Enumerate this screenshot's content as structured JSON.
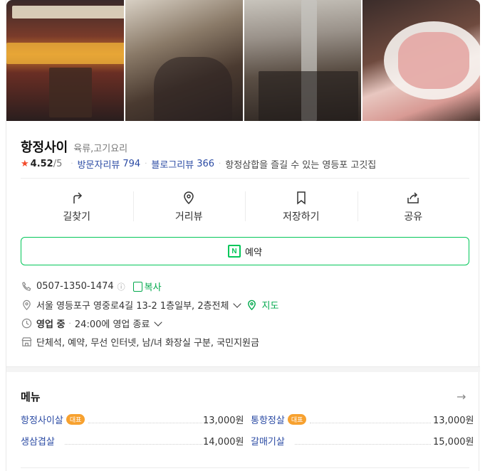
{
  "place": {
    "name": "항정사이",
    "category": "육류,고기요리",
    "rating": "4.52",
    "rating_max": "/5",
    "visitor_reviews_label": "방문자리뷰",
    "visitor_reviews_count": "794",
    "blog_reviews_label": "블로그리뷰",
    "blog_reviews_count": "366",
    "description": "항정삼합을 즐길 수 있는 영등포 고깃집"
  },
  "photos": [
    "storefront-photo",
    "interior-photo",
    "dining-room-photo",
    "meat-plate-photo"
  ],
  "actions": [
    {
      "label": "길찾기",
      "icon": "directions-icon"
    },
    {
      "label": "거리뷰",
      "icon": "location-pin-icon"
    },
    {
      "label": "저장하기",
      "icon": "bookmark-icon"
    },
    {
      "label": "공유",
      "icon": "share-icon"
    }
  ],
  "reserve": {
    "label": "예약",
    "icon_letter": "N"
  },
  "info": {
    "phone": "0507-1350-1474",
    "phone_help": "ⓘ",
    "copy_label": "복사",
    "address": "서울 영등포구 영중로4길 13-2 1층일부, 2층전체",
    "map_label": "지도",
    "status": "영업 중",
    "hours": "24:00에 영업 종료",
    "amenities": "단체석, 예약, 무선 인터넷, 남/녀 화장실 구분, 국민지원금"
  },
  "menu": {
    "title": "메뉴",
    "arrow": "→",
    "items": [
      {
        "name": "항정사이살",
        "badge": "대표",
        "price": "13,000원"
      },
      {
        "name": "통항정살",
        "badge": "대표",
        "price": "13,000원"
      },
      {
        "name": "생삼겹살",
        "badge": "",
        "price": "14,000원"
      },
      {
        "name": "갈매기살",
        "badge": "",
        "price": "15,000원"
      }
    ]
  },
  "colors": {
    "accent_green": "#03c75a",
    "link_blue": "#2b4ba4",
    "star_red": "#f34a2b",
    "badge_orange": "#f7a12f"
  }
}
